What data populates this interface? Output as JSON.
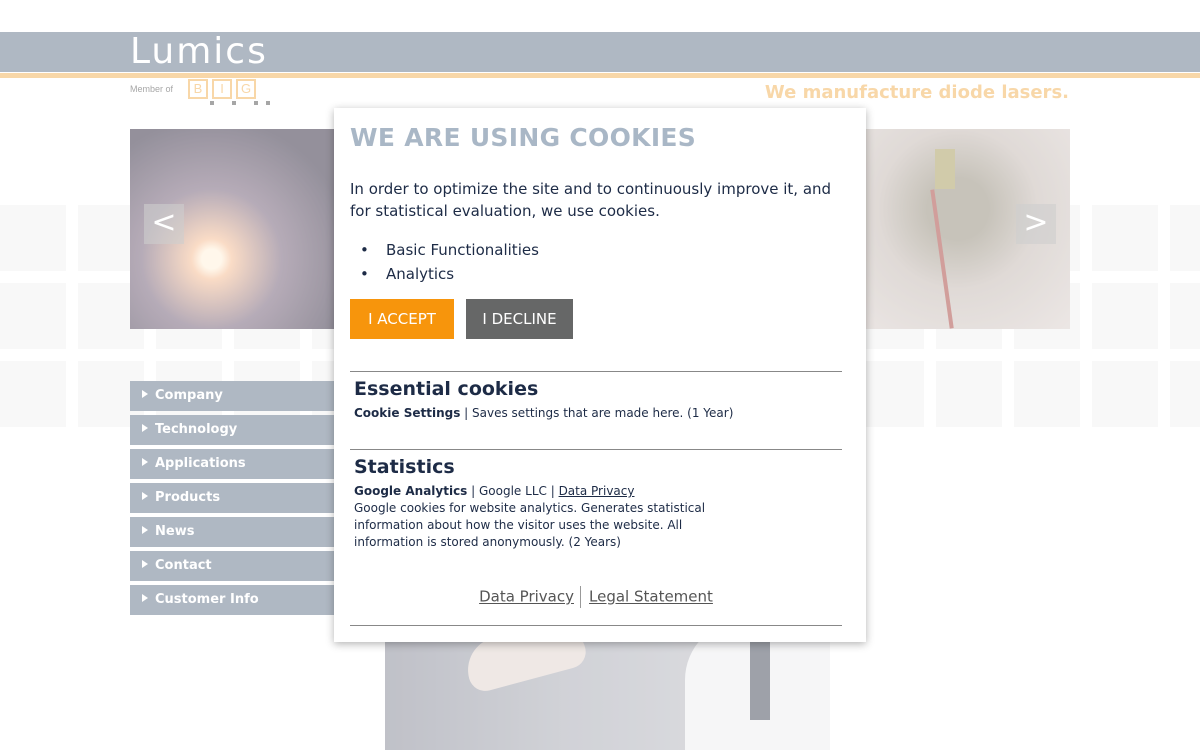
{
  "header": {
    "logo_text": "Lumics",
    "member_text": "Member of",
    "big_letters": [
      "B",
      "I",
      "G"
    ],
    "tagline": "We manufacture diode lasers."
  },
  "slider": {
    "prev_icon": "chevron-left-icon",
    "next_icon": "chevron-right-icon",
    "prev_label": "<",
    "next_label": ">"
  },
  "nav": {
    "items": [
      {
        "label": "Company"
      },
      {
        "label": "Technology"
      },
      {
        "label": "Applications"
      },
      {
        "label": "Products"
      },
      {
        "label": "News"
      },
      {
        "label": "Contact"
      },
      {
        "label": "Customer Info"
      }
    ]
  },
  "cookie_dialog": {
    "title": "WE ARE USING COOKIES",
    "intro": "In order to optimize the site and to continuously improve it, and for statistical evaluation, we use cookies.",
    "list": [
      "Basic Functionalities",
      "Analytics"
    ],
    "accept_label": "I ACCEPT",
    "decline_label": "I DECLINE",
    "essential": {
      "title": "Essential cookies",
      "name": "Cookie Settings",
      "separator": " | ",
      "desc": "Saves settings that are made here. (1 Year)"
    },
    "statistics": {
      "title": "Statistics",
      "name": "Google Analytics",
      "separator": " | ",
      "provider": "Google LLC",
      "separator2": " | ",
      "privacy_link": "Data Privacy",
      "desc": "Google cookies for website analytics. Generates statistical information about how the visitor uses the website. All information is stored anonymously. (2 Years)"
    },
    "footer": {
      "privacy": "Data Privacy",
      "legal": "Legal Statement"
    }
  },
  "colors": {
    "header_bar": "#8592a3",
    "accent_orange": "#f4c27a",
    "accept_button": "#f7950c",
    "decline_button": "#666767",
    "title_gray": "#a9b7c6",
    "text_navy": "#1d2b46"
  }
}
